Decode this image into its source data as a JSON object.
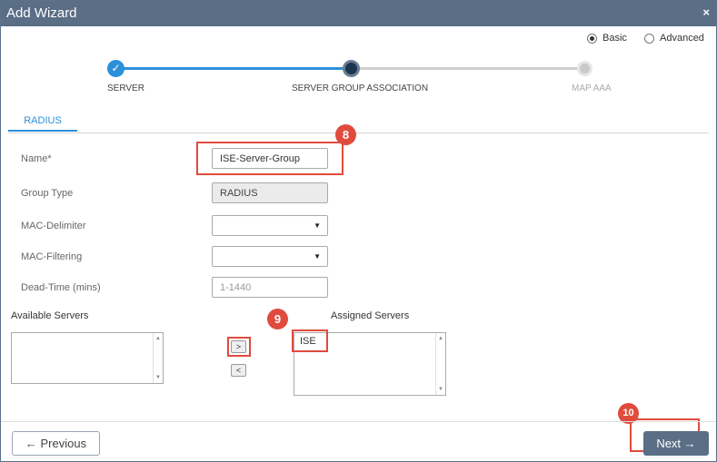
{
  "window": {
    "title": "Add Wizard",
    "close_glyph": "×"
  },
  "mode": {
    "basic_label": "Basic",
    "advanced_label": "Advanced",
    "selected": "Basic"
  },
  "steps": [
    {
      "label": "SERVER",
      "state": "done"
    },
    {
      "label": "SERVER GROUP ASSOCIATION",
      "state": "current"
    },
    {
      "label": "MAP AAA",
      "state": "pending"
    }
  ],
  "tab": {
    "label": "RADIUS"
  },
  "form": {
    "name_label": "Name*",
    "name_value": "ISE-Server-Group",
    "group_type_label": "Group Type",
    "group_type_value": "RADIUS",
    "mac_delimiter_label": "MAC-Delimiter",
    "mac_delimiter_value": "",
    "mac_filtering_label": "MAC-Filtering",
    "mac_filtering_value": "",
    "dead_time_label": "Dead-Time (mins)",
    "dead_time_placeholder": "1-1440"
  },
  "servers": {
    "available_label": "Available Servers",
    "assigned_label": "Assigned Servers",
    "available_items": [],
    "assigned_items": [
      "ISE"
    ],
    "move_right_glyph": ">",
    "move_left_glyph": "<"
  },
  "annotations": {
    "badge_8": "8",
    "badge_9": "9",
    "badge_10": "10"
  },
  "footer": {
    "previous_label": "Previous",
    "next_label": "Next",
    "prev_icon": "←",
    "next_icon": "→"
  },
  "colors": {
    "accent": "#2b90d9",
    "titlebar": "#5a6e86",
    "highlight": "#e04b3e",
    "step_done": "#2b90d9",
    "step_current": "#1c3650",
    "step_pending": "#cfcfcf"
  }
}
